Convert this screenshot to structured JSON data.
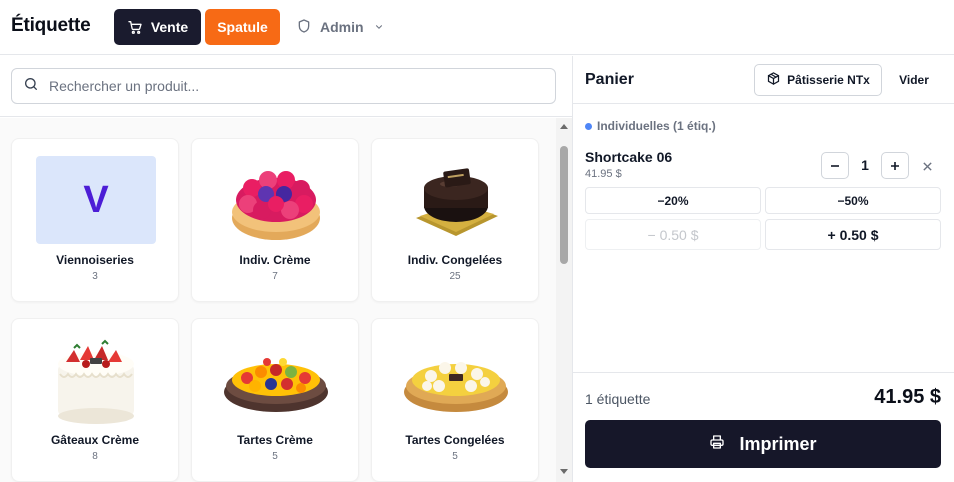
{
  "header": {
    "title": "Étiquette",
    "vente_label": "Vente",
    "spatule_label": "Spatule",
    "admin_label": "Admin"
  },
  "search": {
    "placeholder": "Rechercher un produit...",
    "value": ""
  },
  "categories": [
    {
      "name": "Viennoiseries",
      "count": "3",
      "letter": "V"
    },
    {
      "name": "Indiv. Crème",
      "count": "7"
    },
    {
      "name": "Indiv. Congelées",
      "count": "25"
    },
    {
      "name": "Gâteaux Crème",
      "count": "8"
    },
    {
      "name": "Tartes Crème",
      "count": "5"
    },
    {
      "name": "Tartes Congelées",
      "count": "5"
    }
  ],
  "cart": {
    "title": "Panier",
    "store_label": "Pâtisserie NTx",
    "clear_label": "Vider",
    "group_label": "Individuelles (1 étiq.)",
    "items": [
      {
        "name": "Shortcake 06",
        "price": "41.95 $",
        "quantity": "1",
        "discounts": [
          "−20%",
          "−50%"
        ],
        "adjust_minus": "− 0.50 $",
        "adjust_plus": "+ 0.50 $"
      }
    ],
    "count_label": "1 étiquette",
    "total": "41.95 $",
    "print_label": "Imprimer"
  },
  "colors": {
    "dark": "#1a1b2e",
    "accent": "#f76a15",
    "tile_bg": "#dbe6fb",
    "tile_letter": "#4c1dd6",
    "group_dot": "#4f86f7"
  },
  "icons": {
    "vente": "cart-icon",
    "admin": "shield-icon",
    "search": "search-icon",
    "store": "package-icon",
    "remove": "close-icon",
    "print": "printer-icon"
  }
}
